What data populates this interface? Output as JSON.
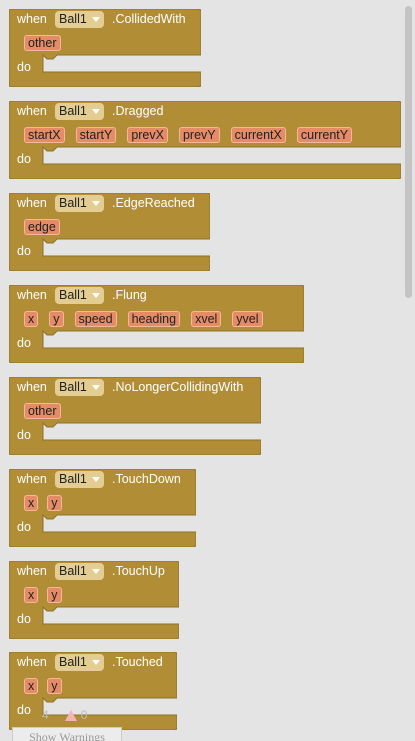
{
  "keywords": {
    "when": "when",
    "do": "do"
  },
  "component": "Ball1",
  "colors": {
    "block": "#b18e35",
    "param": "#e58b66",
    "dropdown": "#e3cd93",
    "workspace": "#e4e4e4"
  },
  "blocks": [
    {
      "event": ".CollidedWith",
      "params": [
        "other"
      ]
    },
    {
      "event": ".Dragged",
      "params": [
        "startX",
        "startY",
        "prevX",
        "prevY",
        "currentX",
        "currentY"
      ]
    },
    {
      "event": ".EdgeReached",
      "params": [
        "edge"
      ]
    },
    {
      "event": ".Flung",
      "params": [
        "x",
        "y",
        "speed",
        "heading",
        "xvel",
        "yvel"
      ]
    },
    {
      "event": ".NoLongerCollidingWith",
      "params": [
        "other"
      ]
    },
    {
      "event": ".TouchDown",
      "params": [
        "x",
        "y"
      ]
    },
    {
      "event": ".TouchUp",
      "params": [
        "x",
        "y"
      ]
    },
    {
      "event": ".Touched",
      "params": [
        "x",
        "y"
      ]
    }
  ],
  "warnings": {
    "warning_count": "4",
    "error_count": "0",
    "show_button": "Show Warnings"
  }
}
